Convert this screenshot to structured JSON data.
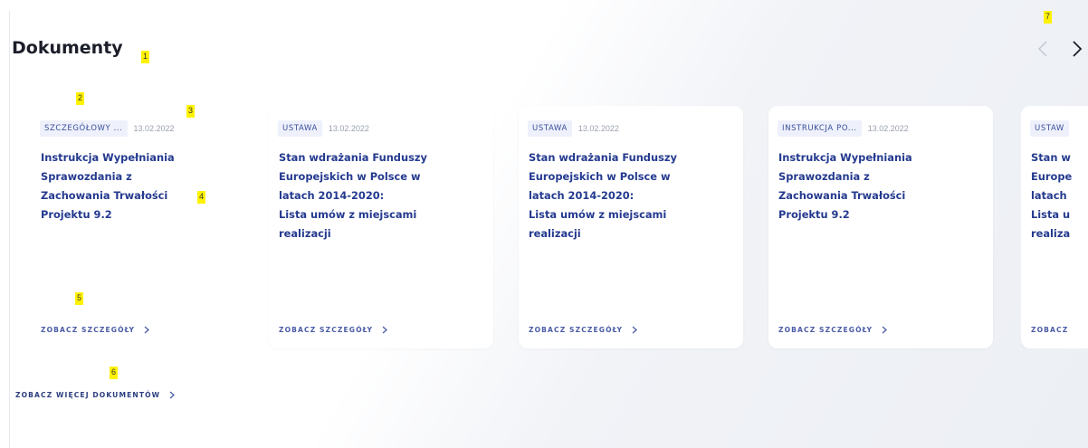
{
  "section": {
    "title": "Dokumenty",
    "more_link": "ZOBACZ WIĘCEJ DOKUMENTÓW"
  },
  "markers": [
    "1",
    "2",
    "3",
    "4",
    "5",
    "6",
    "7"
  ],
  "navigation": {
    "prev_icon": "chevron-left-icon",
    "next_icon": "chevron-right-icon"
  },
  "cards": [
    {
      "tag": "SZCZEGÓŁOWY ...",
      "date": "13.02.2022",
      "title": "Instrukcja Wypełniania\nSprawozdania z\nZachowania Trwałości\nProjektu 9.2",
      "link": "ZOBACZ SZCZEGÓŁY"
    },
    {
      "tag": "USTAWA",
      "date": "13.02.2022",
      "title": "Stan wdrażania Funduszy\nEuropejskich w Polsce w\nlatach 2014-2020:\nLista umów z miejscami\nrealizacji",
      "link": "ZOBACZ SZCZEGÓŁY"
    },
    {
      "tag": "USTAWA",
      "date": "13.02.2022",
      "title": "Stan wdrażania Funduszy\nEuropejskich w Polsce w\nlatach 2014-2020:\nLista umów z miejscami\nrealizacji",
      "link": "ZOBACZ SZCZEGÓŁY"
    },
    {
      "tag": "INSTRUKCJA PO...",
      "date": "13.02.2022",
      "title": "Instrukcja Wypełniania\nSprawozdania z\nZachowania Trwałości\nProjektu 9.2",
      "link": "ZOBACZ SZCZEGÓŁY"
    },
    {
      "tag": "USTAW",
      "title": "Stan w\nEurope\nlatach\nLista u\nrealiza",
      "link": "ZOBACZ"
    }
  ],
  "colors": {
    "accent": "#243a8f",
    "tag_background": "#eef1fb",
    "marker": "#fff200"
  }
}
